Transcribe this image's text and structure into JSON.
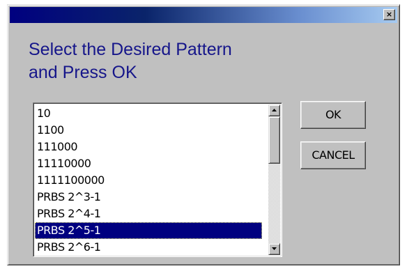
{
  "window": {
    "title": "",
    "close_label": "×"
  },
  "prompt": {
    "line1": "Select the Desired Pattern",
    "line2": "and Press OK"
  },
  "pattern_list": {
    "items": [
      "10",
      "1100",
      "111000",
      "11110000",
      "1111100000",
      "PRBS 2^3-1",
      "PRBS 2^4-1",
      "PRBS 2^5-1",
      "PRBS 2^6-1"
    ],
    "selected_index": 7,
    "selected_value": "PRBS 2^5-1"
  },
  "buttons": {
    "ok_label": "OK",
    "cancel_label": "CANCEL"
  },
  "colors": {
    "titlebar_start": "#000080",
    "titlebar_end": "#a6caf0",
    "dialog_face": "#c0c0c0",
    "prompt_text": "#16168a",
    "selection_bg": "#000080",
    "selection_text": "#ffffff"
  },
  "icons": {
    "close": "close-icon",
    "scroll_up": "arrow-up-icon",
    "scroll_down": "arrow-down-icon"
  }
}
